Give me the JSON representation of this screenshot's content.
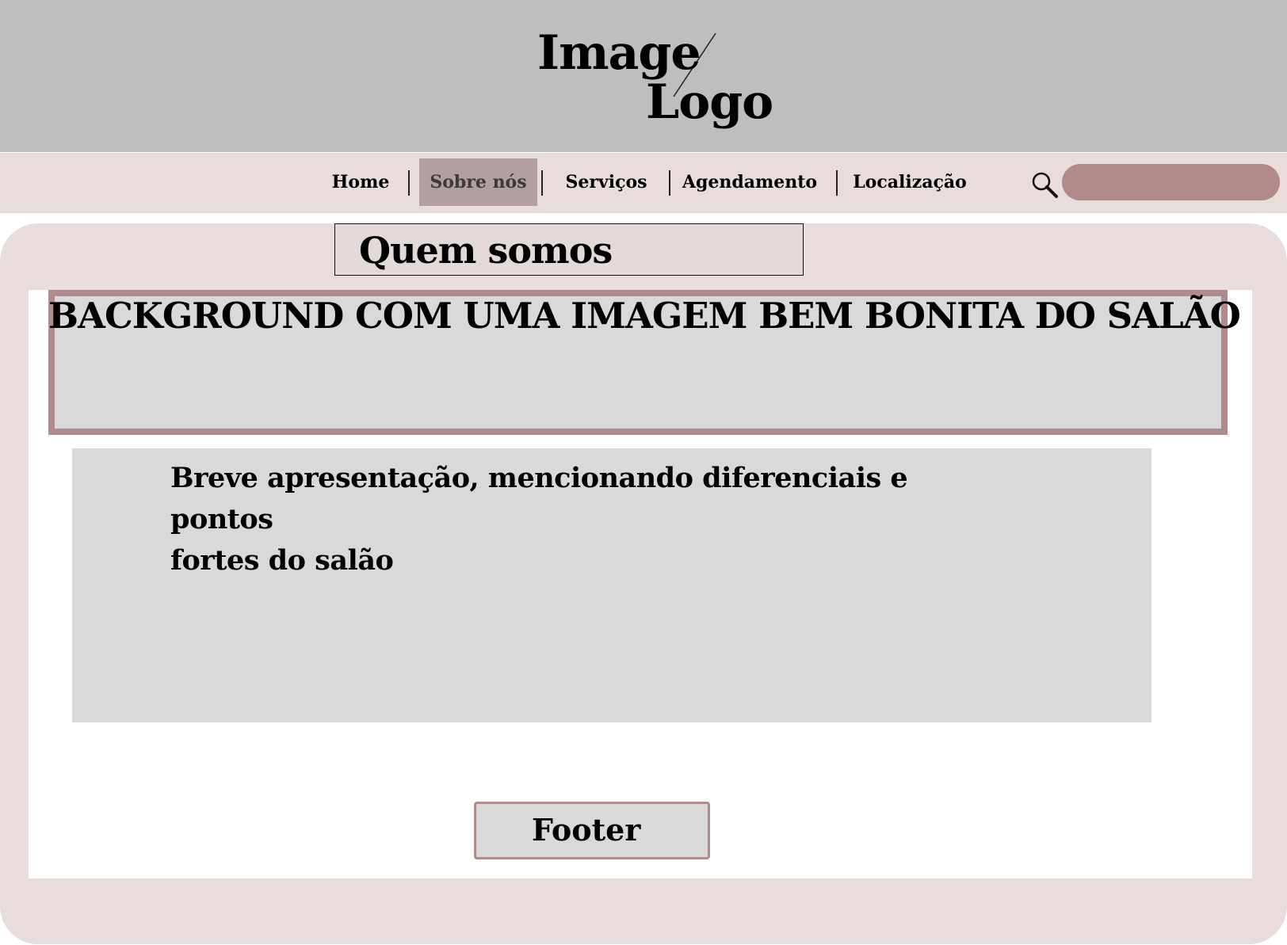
{
  "header": {
    "logo_line1": "Image",
    "logo_line2": "Logo"
  },
  "nav": {
    "items": [
      {
        "label": "Home"
      },
      {
        "label": "Sobre nós",
        "active": true
      },
      {
        "label": "Serviços"
      },
      {
        "label": "Agendamento"
      },
      {
        "label": "Localização"
      }
    ],
    "search_icon": "search-icon",
    "search_placeholder": ""
  },
  "main": {
    "section_title": "Quem somos",
    "hero_text": "BACKGROUND COM UMA IMAGEM BEM BONITA DO SALÃO",
    "intro_line1": "Breve apresentação, mencionando diferenciais e pontos",
    "intro_line2": "fortes do salão",
    "footer_label": "Footer"
  },
  "colors": {
    "header_bg": "#bebebe",
    "nav_bg": "#e8dcdc",
    "accent": "#b18b8c",
    "active_tab": "#b29f9f",
    "placeholder_box": "#d9d9d9"
  }
}
